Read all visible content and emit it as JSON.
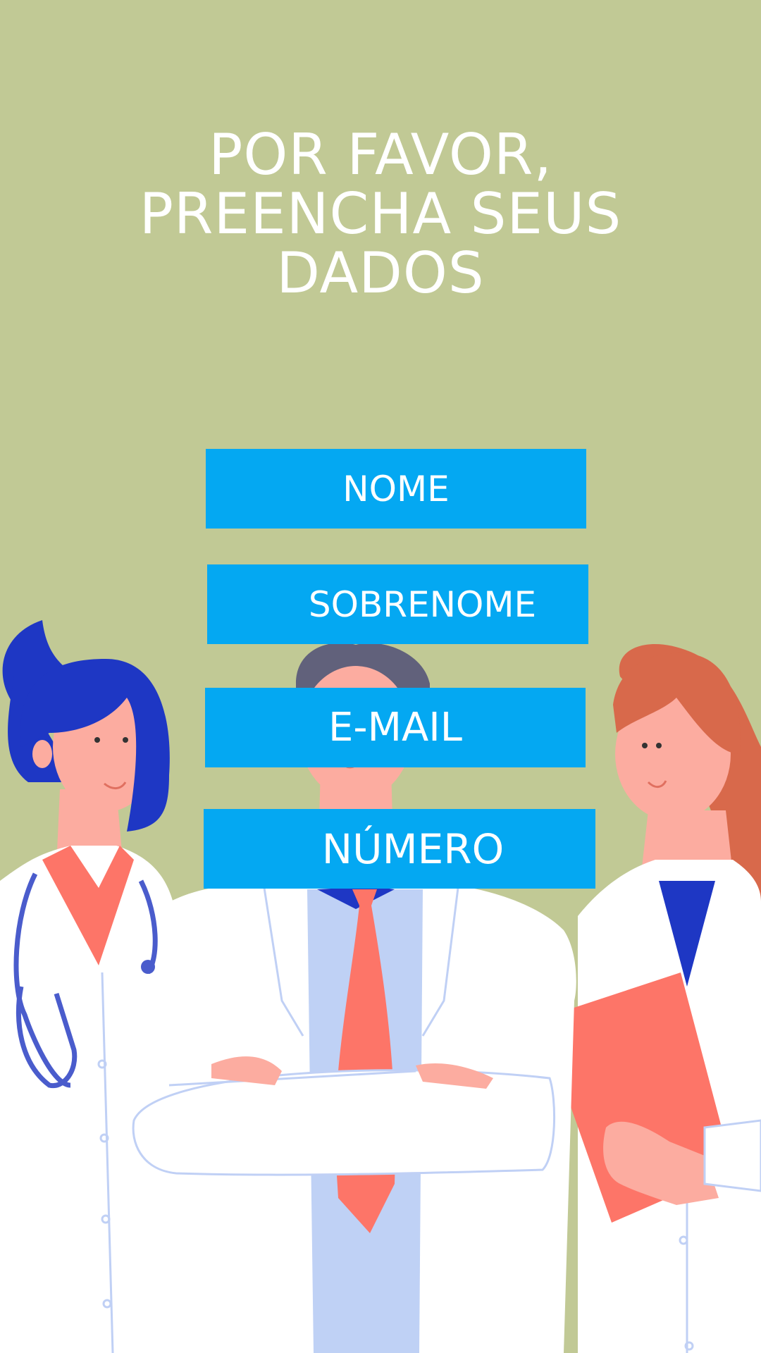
{
  "title": {
    "line1": "POR FAVOR,",
    "line2": "PREENCHA SEUS",
    "line3": "DADOS"
  },
  "form": {
    "nome_label": "NOME",
    "sobrenome_label": "SOBRENOME",
    "email_label": "E-MAIL",
    "numero_label": "NÚMERO"
  },
  "colors": {
    "background": "#c1c995",
    "button": "#04a8f2",
    "text": "#ffffff"
  },
  "illustration": {
    "subject": "three-doctors-illustration"
  }
}
